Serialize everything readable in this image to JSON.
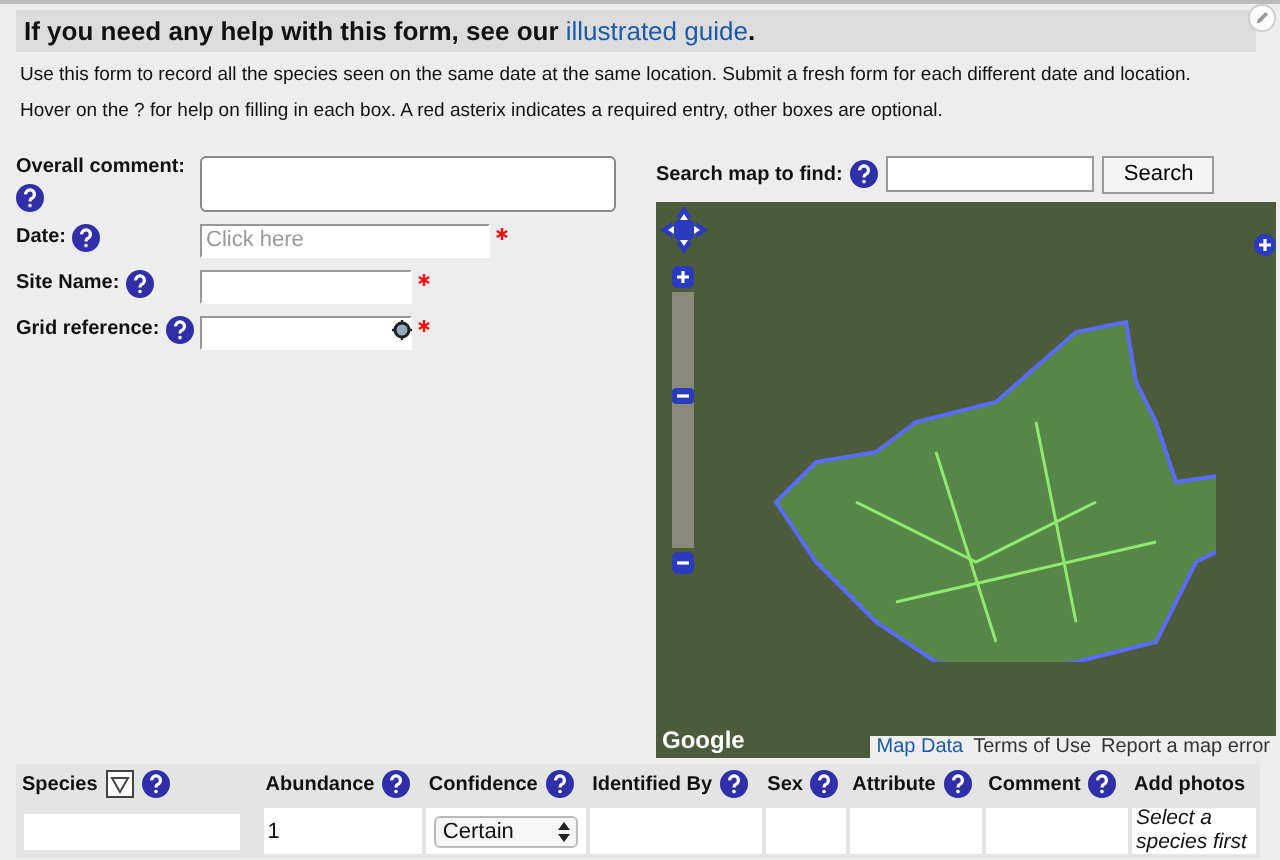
{
  "help_banner": {
    "text": "If you need any help with this form, see our ",
    "link": "illustrated guide",
    "end": "."
  },
  "intro": [
    "Use this form to record all the species seen on the same date at the same location. Submit a fresh form for each different date and location.",
    "Hover on the ? for help on filling in each box. A red asterix indicates a required entry, other boxes are optional."
  ],
  "fields": [
    {
      "label": "Overall comment:",
      "kind": "textarea",
      "required": false
    },
    {
      "label": "Date:",
      "kind": "text",
      "placeholder": "Click here",
      "required": true
    },
    {
      "label": "Site Name:",
      "kind": "text",
      "required": true
    },
    {
      "label": "Grid reference:",
      "kind": "gridref",
      "required": true
    }
  ],
  "map_search": {
    "label": "Search map to find:",
    "button": "Search"
  },
  "map": {
    "zoom": {
      "level": 0.6
    },
    "attribution": "Google",
    "links": [
      "Map Data",
      "Terms of Use",
      "Report a map error"
    ]
  },
  "table": {
    "columns": [
      {
        "label": "Species",
        "filter": true
      },
      {
        "label": "Abundance",
        "filter": false
      },
      {
        "label": "Confidence",
        "filter": false
      },
      {
        "label": "Identified By",
        "filter": false
      },
      {
        "label": "Sex",
        "filter": false
      },
      {
        "label": "Attribute",
        "filter": false
      },
      {
        "label": "Comment",
        "filter": false
      },
      {
        "label": "Add photos",
        "filter": false,
        "help": false
      }
    ],
    "row": {
      "abundance": "1",
      "confidence": "Certain",
      "photos_note": "Select a species first"
    }
  }
}
